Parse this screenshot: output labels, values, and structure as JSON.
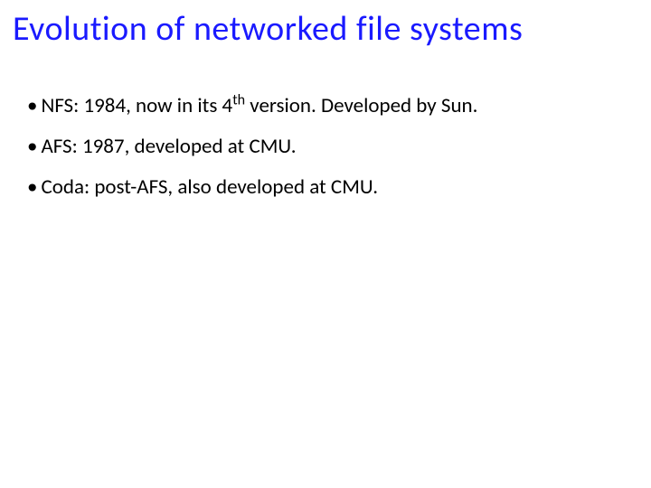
{
  "title": "Evolution of networked file systems",
  "bullets": {
    "item0_prefix": "NFS: 1984, now in its 4",
    "item0_sup": "th",
    "item0_suffix": " version. Developed by Sun.",
    "item1": "AFS: 1987, developed at CMU.",
    "item2": "Coda: post-AFS, also developed at CMU."
  }
}
